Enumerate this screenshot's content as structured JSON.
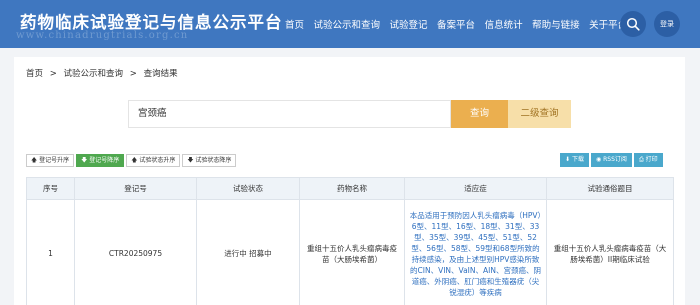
{
  "header": {
    "title": "药物临床试验登记与信息公示平台",
    "watermark_url": "www.chinadrugtrials.org.cn",
    "nav": [
      "首页",
      "试验公示和查询",
      "试验登记",
      "备案平台",
      "信息统计",
      "帮助与链接",
      "关于平台"
    ],
    "login_label": "登录",
    "bg_color": "#3f77c0"
  },
  "breadcrumb": {
    "home": "首页",
    "sep": ">",
    "section": "试验公示和查询",
    "current": "查询结果"
  },
  "search": {
    "value": "宫颈癌",
    "query_button": "查询",
    "second_query_button": "二级查询"
  },
  "sort_buttons": [
    "登记号升序",
    "登记号降序",
    "试验状态升序",
    "试验状态降序"
  ],
  "active_sort": "登记号降序",
  "tools": [
    "下载",
    "RSS订阅",
    "打印"
  ],
  "table": {
    "headers": [
      "序号",
      "登记号",
      "试验状态",
      "药物名称",
      "适应症",
      "试验通俗题目"
    ],
    "rows": [
      {
        "index": "1",
        "reg_no": "CTR20250975",
        "status": "进行中 招募中",
        "drug": "重组十五价人乳头瘤病毒疫苗（大肠埃希菌）",
        "indication": "本品适用于预防因人乳头瘤病毒（HPV）6型、11型、16型、18型、31型、33型、35型、39型、45型、51型、52型、56型、58型、59型和68型所致的持续感染，及由上述型别HPV感染所致的CIN、VIN、VaIN、AIN、宫颈癌、阴道癌、外阴癌、肛门癌和生殖器疣（尖锐湿疣）等疾病",
        "title": "重组十五价人乳头瘤病毒疫苗（大肠埃希菌）II期临床试验"
      }
    ]
  }
}
